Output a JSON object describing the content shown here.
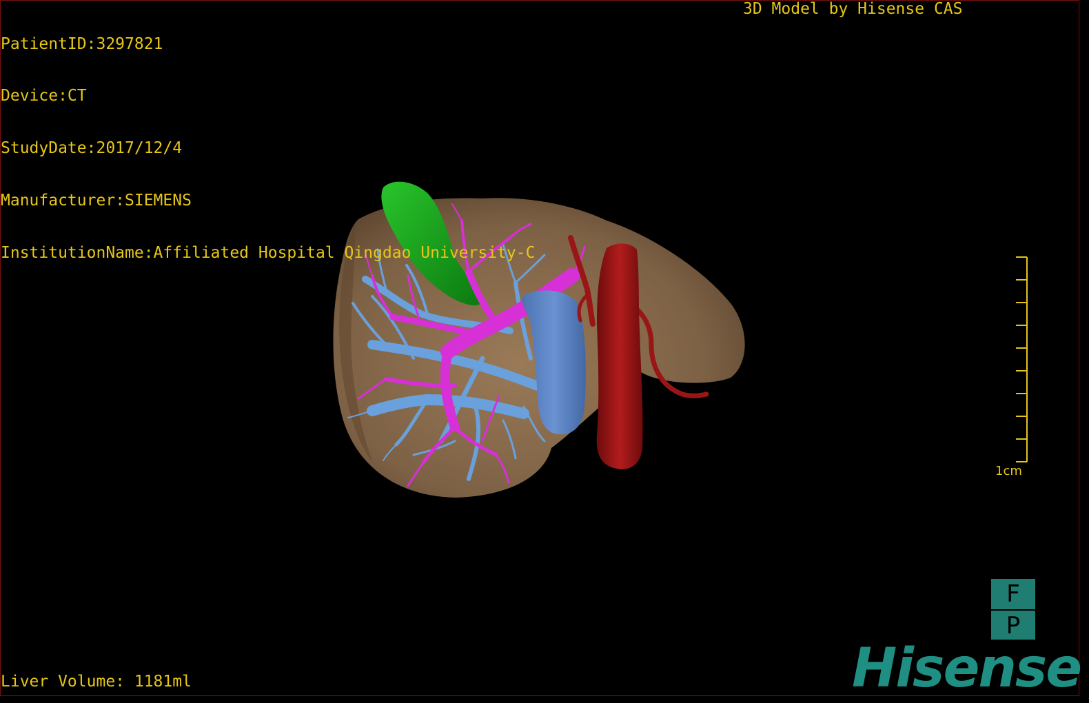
{
  "header_info": {
    "patient_id": "PatientID:3297821",
    "device": "Device:CT",
    "study_date": "StudyDate:2017/12/4",
    "manufacturer": "Manufacturer:SIEMENS",
    "institution": "InstitutionName:Affiliated Hospital Qingdao University-C"
  },
  "credit": "3D Model by Hisense CAS",
  "footer": {
    "liver_volume": "Liver Volume: 1181ml"
  },
  "scale_bar": {
    "label": "1cm",
    "tick_count": 10
  },
  "orientation_cube": {
    "top": "F",
    "bottom": "P"
  },
  "logo": "Hisense",
  "colors": {
    "text": "#e6c619",
    "liver": "#85694b",
    "gallbladder": "#19a01e",
    "portal_vein": "#d630d6",
    "hepatic_vein": "#6aa0dc",
    "ivc": "#5f86c4",
    "aorta": "#9a1616",
    "brand": "#1f8f84"
  }
}
